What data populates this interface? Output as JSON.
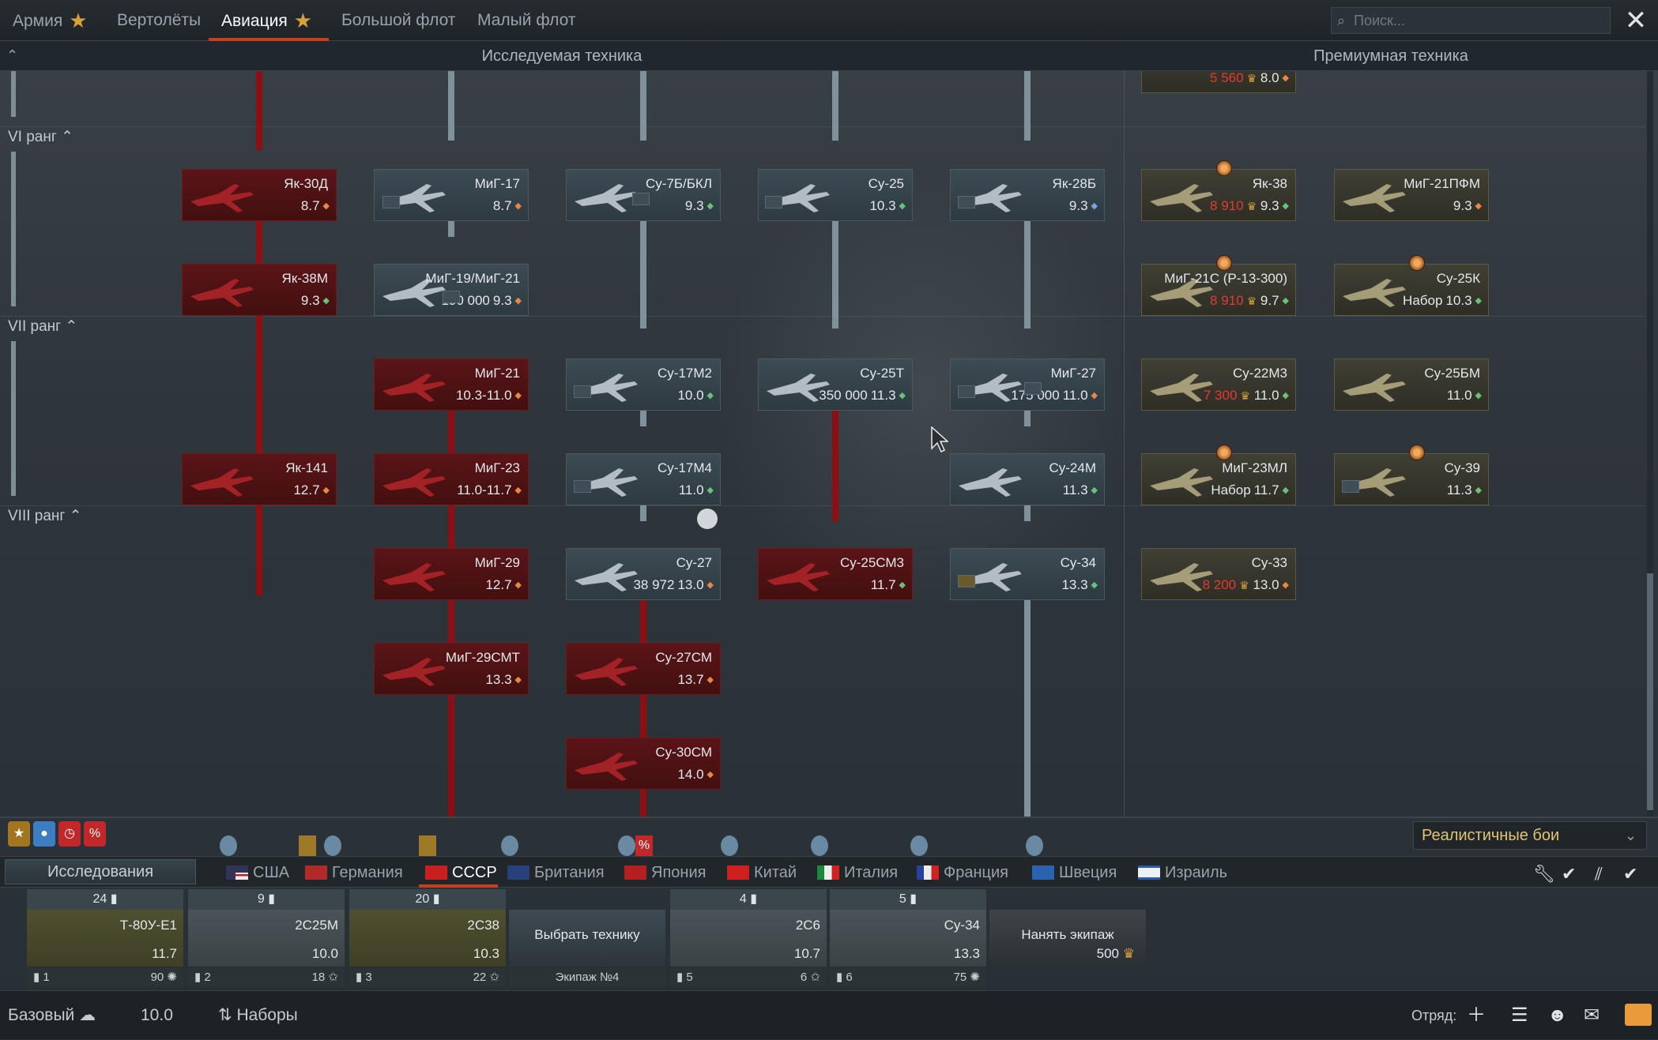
{
  "tabs": [
    {
      "label": "Армия",
      "star": true,
      "active": false
    },
    {
      "label": "Вертолёты",
      "star": false,
      "active": false
    },
    {
      "label": "Авиация",
      "star": true,
      "active": true
    },
    {
      "label": "Большой флот",
      "star": false,
      "active": false
    },
    {
      "label": "Малый флот",
      "star": false,
      "active": false
    }
  ],
  "search": {
    "placeholder": "Поиск..."
  },
  "headers": {
    "research": "Исследуемая техника",
    "premium": "Премиумная техника"
  },
  "ranks": [
    {
      "label": "VI ранг"
    },
    {
      "label": "VII ранг"
    },
    {
      "label": "VIII ранг"
    }
  ],
  "tree": {
    "top_partial": {
      "cost": "5 560",
      "br": "8.0",
      "brcolor": "o"
    },
    "cards": [
      {
        "name": "Як-30Д",
        "br": "8.7",
        "brcolor": "o",
        "style": "red"
      },
      {
        "name": "Як-38М",
        "br": "9.3",
        "brcolor": "g",
        "style": "red"
      },
      {
        "name": "Як-141",
        "br": "12.7",
        "brcolor": "o",
        "style": "red"
      },
      {
        "name": "МиГ-17",
        "br": "8.7",
        "brcolor": "o",
        "style": "grey"
      },
      {
        "name": "МиГ-19/МиГ-21",
        "rp": "190 000",
        "br": "9.3",
        "brcolor": "o",
        "style": "grey"
      },
      {
        "name": "МиГ-21",
        "br": "10.3-11.0",
        "brcolor": "o",
        "style": "red"
      },
      {
        "name": "МиГ-23",
        "br": "11.0-11.7",
        "brcolor": "o",
        "style": "red"
      },
      {
        "name": "МиГ-29",
        "br": "12.7",
        "brcolor": "o",
        "style": "red"
      },
      {
        "name": "МиГ-29СМТ",
        "br": "13.3",
        "brcolor": "o",
        "style": "red"
      },
      {
        "name": "Су-7Б/БКЛ",
        "br": "9.3",
        "brcolor": "g",
        "style": "grey"
      },
      {
        "name": "Су-17М2",
        "br": "10.0",
        "brcolor": "g",
        "style": "grey"
      },
      {
        "name": "Су-17М4",
        "br": "11.0",
        "brcolor": "g",
        "style": "grey"
      },
      {
        "name": "Су-27",
        "rp": "38 972",
        "br": "13.0",
        "brcolor": "o",
        "style": "grey"
      },
      {
        "name": "Су-27СМ",
        "br": "13.7",
        "brcolor": "o",
        "style": "red"
      },
      {
        "name": "Су-30СМ",
        "br": "14.0",
        "brcolor": "o",
        "style": "red"
      },
      {
        "name": "Су-25",
        "br": "10.3",
        "brcolor": "g",
        "style": "grey"
      },
      {
        "name": "Су-25Т",
        "rp": "350 000",
        "br": "11.3",
        "brcolor": "g",
        "style": "grey"
      },
      {
        "name": "Су-25СМ3",
        "br": "11.7",
        "brcolor": "g",
        "style": "red"
      },
      {
        "name": "Як-28Б",
        "br": "9.3",
        "brcolor": "b",
        "style": "grey"
      },
      {
        "name": "МиГ-27",
        "rp": "175 000",
        "br": "11.0",
        "brcolor": "o",
        "style": "grey"
      },
      {
        "name": "Су-24М",
        "br": "11.3",
        "brcolor": "g",
        "style": "grey"
      },
      {
        "name": "Су-34",
        "br": "13.3",
        "brcolor": "g",
        "style": "grey"
      },
      {
        "name": "Як-38",
        "cost": "8 910",
        "br": "9.3",
        "brcolor": "g",
        "style": "prem"
      },
      {
        "name": "МиГ-21С (Р-13-300)",
        "cost": "8 910",
        "br": "9.7",
        "brcolor": "g",
        "style": "prem"
      },
      {
        "name": "Су-22М3",
        "cost": "7 300",
        "br": "11.0",
        "brcolor": "g",
        "style": "prem"
      },
      {
        "name": "МиГ-23МЛ",
        "pack": "Набор",
        "br": "11.7",
        "brcolor": "g",
        "style": "prem"
      },
      {
        "name": "Су-33",
        "cost": "8 200",
        "br": "13.0",
        "brcolor": "o",
        "style": "prem"
      },
      {
        "name": "МиГ-21ПФМ",
        "br": "9.3",
        "brcolor": "o",
        "style": "prem"
      },
      {
        "name": "Су-25К",
        "pack": "Набор",
        "br": "10.3",
        "brcolor": "g",
        "style": "prem"
      },
      {
        "name": "Су-25БМ",
        "br": "11.0",
        "brcolor": "g",
        "style": "prem"
      },
      {
        "name": "Су-39",
        "br": "11.3",
        "brcolor": "g",
        "style": "prem"
      }
    ]
  },
  "mode": {
    "label": "Реалистичные бои"
  },
  "research_button": {
    "label": "Исследования"
  },
  "nations": [
    {
      "label": "США",
      "active": false
    },
    {
      "label": "Германия",
      "active": false
    },
    {
      "label": "СССР",
      "active": true
    },
    {
      "label": "Британия",
      "active": false
    },
    {
      "label": "Япония",
      "active": false
    },
    {
      "label": "Китай",
      "active": false
    },
    {
      "label": "Италия",
      "active": false
    },
    {
      "label": "Франция",
      "active": false
    },
    {
      "label": "Швеция",
      "active": false
    },
    {
      "label": "Израиль",
      "active": false
    }
  ],
  "crew": [
    {
      "count": "24",
      "name": "Т-80У-Е1",
      "br": "11.7",
      "slot": "1",
      "level": "90"
    },
    {
      "count": "9",
      "name": "2С25М",
      "br": "10.0",
      "slot": "2",
      "level": "18"
    },
    {
      "count": "20",
      "name": "2С38",
      "br": "10.3",
      "slot": "3",
      "level": "22"
    },
    {
      "special": "Выбрать технику",
      "bottom": "Экипаж №4"
    },
    {
      "count": "4",
      "name": "2С6",
      "br": "10.7",
      "slot": "5",
      "level": "6"
    },
    {
      "count": "5",
      "name": "Су-34",
      "br": "13.3",
      "slot": "6",
      "level": "75"
    },
    {
      "special": "Нанять экипаж",
      "cost": "500"
    }
  ],
  "bottombar": {
    "mode": "Базовый",
    "br": "10.0",
    "packs": "Наборы",
    "squad": "Отряд:"
  },
  "colors": {
    "accent": "#c4401f",
    "gold": "#d8a23a",
    "redline": "#8d0f14",
    "greyline": "#7f929c"
  }
}
